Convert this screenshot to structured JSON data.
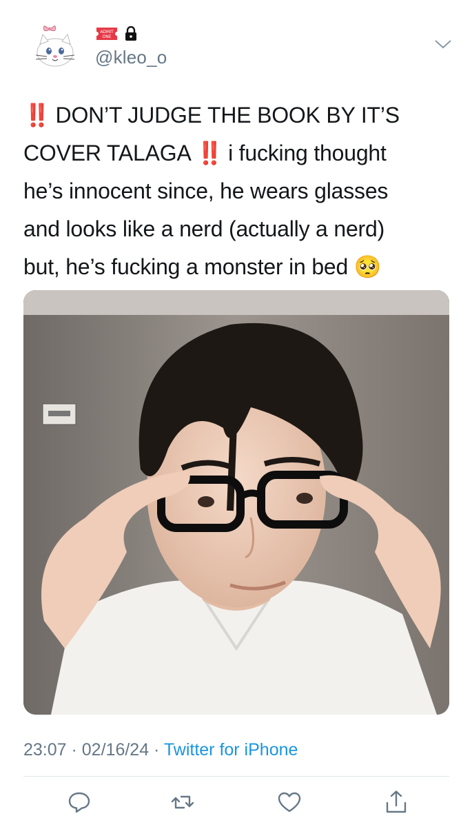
{
  "header": {
    "handle": "@kleo_o",
    "ticket_text_1": "ADMIT",
    "ticket_text_2": "ONE"
  },
  "tweet": {
    "lines": [
      {
        "pre_bang": "‼️",
        "text": " DON’T JUDGE THE BOOK BY IT’S"
      },
      {
        "text": "COVER TALAGA ",
        "bang": "‼️",
        "post": " i fucking thought"
      },
      {
        "text": "he’s innocent since, he wears glasses"
      },
      {
        "text": "and looks like a nerd (actually a nerd)"
      },
      {
        "text": "but, he’s fucking a monster in bed ",
        "emoji": "🥺"
      }
    ]
  },
  "meta": {
    "time": "23:07",
    "separator": " · ",
    "date": "02/16/24",
    "separator2": " · ",
    "source": "Twitter for iPhone"
  },
  "icons": {
    "avatar": "cat-avatar-icon",
    "ticket": "admit-one-ticket-icon",
    "lock": "lock-icon",
    "caret": "chevron-down-icon",
    "reply": "reply-icon",
    "retweet": "retweet-icon",
    "like": "heart-icon",
    "share": "share-icon"
  },
  "colors": {
    "text": "#14171a",
    "muted": "#657786",
    "link": "#1b95e0",
    "alert": "#e0262d"
  }
}
